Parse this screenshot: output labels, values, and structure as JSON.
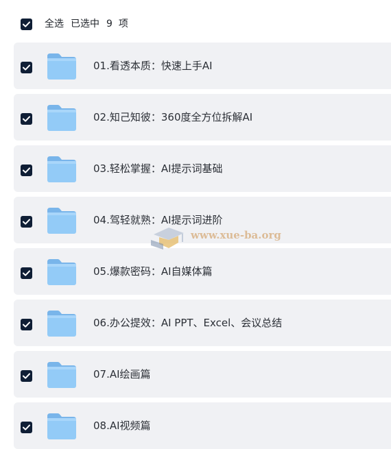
{
  "header": {
    "select_all_label": "全选",
    "selected_prefix": "已选中",
    "selected_count": "9",
    "selected_suffix": "项",
    "all_checked": true
  },
  "items": [
    {
      "label": "01.看透本质：快速上手AI",
      "checked": true,
      "icon": "folder-icon"
    },
    {
      "label": "02.知己知彼：360度全方位拆解AI",
      "checked": true,
      "icon": "folder-icon"
    },
    {
      "label": "03.轻松掌握：AI提示词基础",
      "checked": true,
      "icon": "folder-icon"
    },
    {
      "label": "04.驾轻就熟：AI提示词进阶",
      "checked": true,
      "icon": "folder-icon"
    },
    {
      "label": "05.爆款密码：AI自媒体篇",
      "checked": true,
      "icon": "folder-icon"
    },
    {
      "label": "06.办公提效：AI PPT、Excel、会议总结",
      "checked": true,
      "icon": "folder-icon"
    },
    {
      "label": "07.AI绘画篇",
      "checked": true,
      "icon": "folder-icon"
    },
    {
      "label": "08.AI视频篇",
      "checked": true,
      "icon": "folder-icon"
    }
  ],
  "watermark": {
    "text": "www.xue-ba.org"
  },
  "colors": {
    "checkbox_fill": "#0f1e35",
    "row_background": "#f0f1f4",
    "folder_blue": "#8ec8f6"
  }
}
